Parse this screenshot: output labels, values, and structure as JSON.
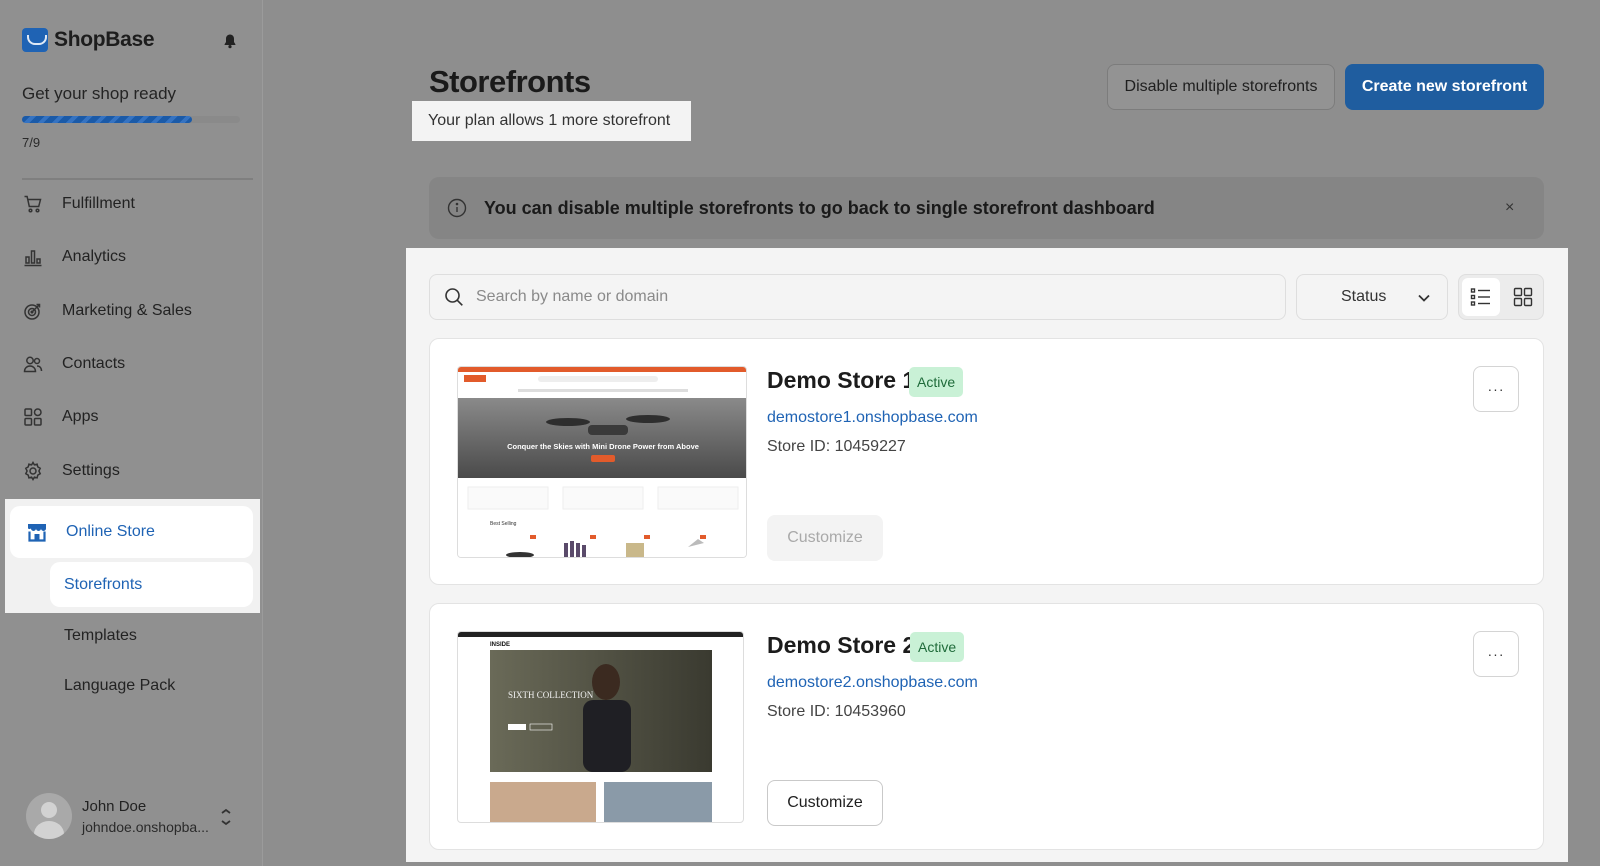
{
  "brand": {
    "name": "ShopBase",
    "color": "#1f63b4"
  },
  "onboarding": {
    "title": "Get your shop ready",
    "progress_text": "7/9",
    "progress_fraction": 0.78
  },
  "sidebar": {
    "items": [
      {
        "label": "Fulfillment",
        "icon": "cart-icon"
      },
      {
        "label": "Analytics",
        "icon": "bar-chart-icon"
      },
      {
        "label": "Marketing & Sales",
        "icon": "target-icon"
      },
      {
        "label": "Contacts",
        "icon": "users-icon"
      },
      {
        "label": "Apps",
        "icon": "apps-icon"
      },
      {
        "label": "Settings",
        "icon": "gear-icon"
      }
    ],
    "online_store": {
      "label": "Online Store",
      "icon": "storefront-icon"
    },
    "sub_items": [
      "Storefronts",
      "Templates",
      "Language Pack"
    ]
  },
  "user": {
    "name": "John Doe",
    "domain": "johndoe.onshopba..."
  },
  "header": {
    "title": "Storefronts",
    "plan_note": "Your plan allows 1 more storefront",
    "disable_button": "Disable multiple storefronts",
    "create_button": "Create new storefront"
  },
  "banner": {
    "text": "You can disable multiple storefronts to go back to single storefront dashboard",
    "close": "×"
  },
  "filters": {
    "search_placeholder": "Search by name or domain",
    "status_label": "Status"
  },
  "stores": [
    {
      "name": "Demo Store 1",
      "status": "Active",
      "domain": "demostore1.onshopbase.com",
      "store_id": "Store ID: 10459227",
      "customize_label": "Customize",
      "customize_enabled": false,
      "thumb": {
        "hero_text": "Conquer the Skies with Mini Drone Power from Above",
        "section_label": "Best Selling"
      }
    },
    {
      "name": "Demo Store 2",
      "status": "Active",
      "domain": "demostore2.onshopbase.com",
      "store_id": "Store ID: 10453960",
      "customize_label": "Customize",
      "customize_enabled": true,
      "thumb": {
        "logo_text": "INSIDE",
        "hero_text": "SIXTH COLLECTION"
      }
    }
  ],
  "more_label": "···",
  "colors": {
    "accent": "#1f5d9f",
    "active_badge_bg": "#c9f1d6",
    "active_badge_text": "#1f6b3a",
    "link": "#1f63b4"
  }
}
